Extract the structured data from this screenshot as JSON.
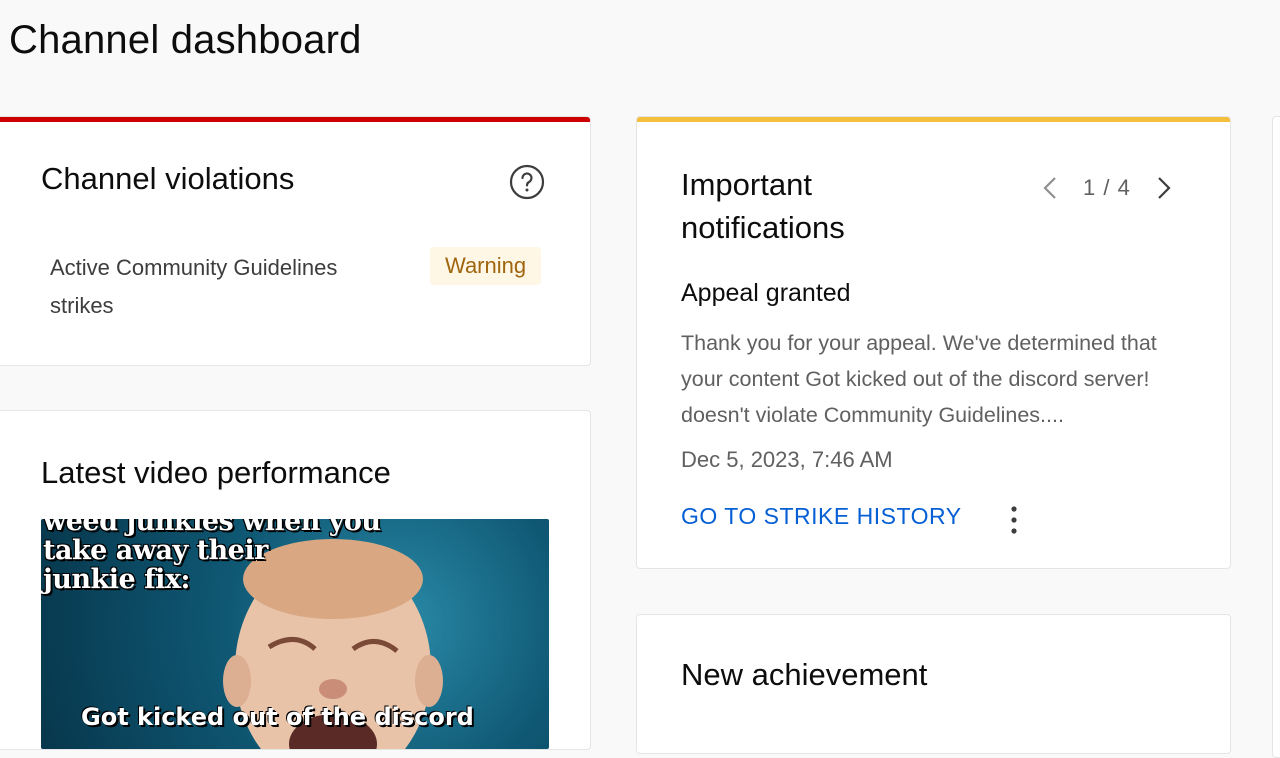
{
  "page": {
    "title": "Channel dashboard"
  },
  "colors": {
    "violations_accent": "#cc0000",
    "notifications_accent": "#f4bf3a",
    "link": "#065fd4",
    "warning_bg": "#fef7e6",
    "warning_text": "#a0650f"
  },
  "violations": {
    "title": "Channel violations",
    "help_icon": "question-circle-icon",
    "label": "Active Community Guidelines strikes",
    "badge": "Warning"
  },
  "video": {
    "title": "Latest video performance",
    "thumbnail_text_top": [
      "weed junkies when you",
      "take away their",
      "junkie fix:"
    ],
    "thumbnail_text_bottom": "Got kicked out of the discord"
  },
  "notifications": {
    "title": "Important notifications",
    "pager": "1 / 4",
    "prev_icon": "chevron-left-icon",
    "next_icon": "chevron-right-icon",
    "heading": "Appeal granted",
    "body": "Thank you for your appeal. We've determined that your content Got kicked out of the discord server! doesn't violate Community Guidelines....",
    "date": "Dec 5, 2023, 7:46 AM",
    "action": "GO TO STRIKE HISTORY",
    "more_icon": "more-vert-icon"
  },
  "achievement": {
    "title": "New achievement"
  }
}
